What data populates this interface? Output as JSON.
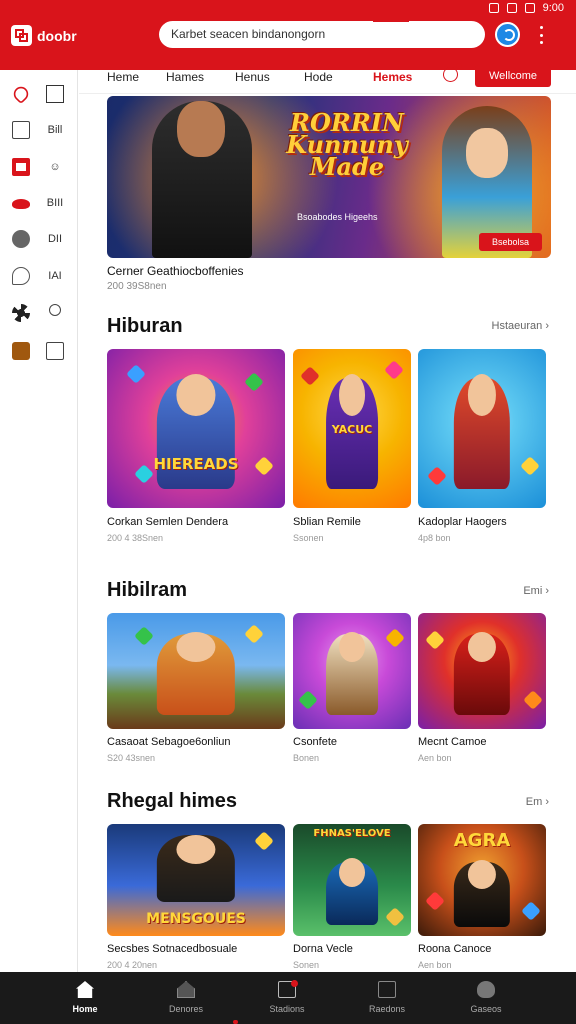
{
  "status": {
    "time": "9:00"
  },
  "header": {
    "logo_text": "doobr",
    "search_placeholder": "Karbet seacen bindanongorn"
  },
  "tabs": [
    {
      "label": "Heme"
    },
    {
      "label": "Hames"
    },
    {
      "label": "Henus"
    },
    {
      "label": "Hode"
    },
    {
      "label": "Hemes"
    }
  ],
  "welcome_button": "Wellcome",
  "sidebar": {
    "items": [
      {
        "icon": "heart-icon",
        "label": ""
      },
      {
        "icon": "grid-icon",
        "label": "Bill"
      },
      {
        "icon": "red-box-icon",
        "label": ""
      },
      {
        "icon": "cloud-icon",
        "label": "BIII"
      },
      {
        "icon": "globe-icon",
        "label": "DII"
      },
      {
        "icon": "chat-icon",
        "label": "IAI"
      },
      {
        "icon": "fan-icon",
        "label": ""
      },
      {
        "icon": "gift-icon",
        "label": ""
      }
    ]
  },
  "hero": {
    "title_line1": "RORRIN",
    "title_line2": "Kunnuny",
    "title_line3": "Made",
    "subtitle": "Bsoabodes Higeehs",
    "button": "Bsebolsa",
    "caption": "Cerner Geathiocboffenies",
    "meta": "200 39S8nen"
  },
  "sections": [
    {
      "title": "Hiburan",
      "more": "Hstaeuran",
      "cards": [
        {
          "title": "Corkan Semlen Dendera",
          "meta": "200 4 38Snen",
          "art_text": "HIEREADS",
          "palette": [
            "#7a1fa8",
            "#e0409a",
            "#ff9a1f"
          ]
        },
        {
          "title": "Sblian Remile",
          "meta": "Ssonen",
          "art_text": "YACUC",
          "palette": [
            "#f7b400",
            "#ff7a00",
            "#6a2fb5"
          ]
        },
        {
          "title": "Kadoplar Haogers",
          "meta": "4p8 bon",
          "art_text": "",
          "palette": [
            "#1b8fd8",
            "#5cc8f0",
            "#e04a2a"
          ]
        }
      ]
    },
    {
      "title": "Hibilram",
      "more": "Emi",
      "cards": [
        {
          "title": "Casaoat Sebagoe6onliun",
          "meta": "S20 43snen",
          "art_text": "",
          "palette": [
            "#2f7fd4",
            "#e09a3a",
            "#6a3a1a"
          ]
        },
        {
          "title": "Csonfete",
          "meta": "Bonen",
          "art_text": "",
          "palette": [
            "#6a2fb5",
            "#c84ad8",
            "#f7b400"
          ]
        },
        {
          "title": "Mecnt Camoe",
          "meta": "Aen bon",
          "art_text": "",
          "palette": [
            "#7a1fa8",
            "#e0302a",
            "#ffb31a"
          ]
        }
      ]
    },
    {
      "title": "Rhegal himes",
      "more": "Em",
      "cards": [
        {
          "title": "Secsbes Sotnacedbosuale",
          "meta": "200 4 20nen",
          "art_text": "MENSGOUES",
          "palette": [
            "#1a3a7a",
            "#3a6ad8",
            "#ff8a1a"
          ]
        },
        {
          "title": "Dorna Vecle",
          "meta": "Sonen",
          "art_text": "FHNAS'ELOVE",
          "palette": [
            "#2a8a4a",
            "#5ac06a",
            "#f0c040"
          ]
        },
        {
          "title": "Roona Canoce",
          "meta": "Aen bon",
          "art_text": "AGRA",
          "palette": [
            "#c8501a",
            "#f0a030",
            "#3a1a0a"
          ]
        }
      ]
    }
  ],
  "bottom_nav": [
    {
      "label": "Home",
      "icon": "home-icon"
    },
    {
      "label": "Denores",
      "icon": "store-icon"
    },
    {
      "label": "Stadions",
      "icon": "document-icon"
    },
    {
      "label": "Raedons",
      "icon": "box-icon"
    },
    {
      "label": "Gaseos",
      "icon": "user-icon"
    }
  ],
  "colors": {
    "brand_red": "#d9141b",
    "nav_dark": "#1a1a1a"
  }
}
